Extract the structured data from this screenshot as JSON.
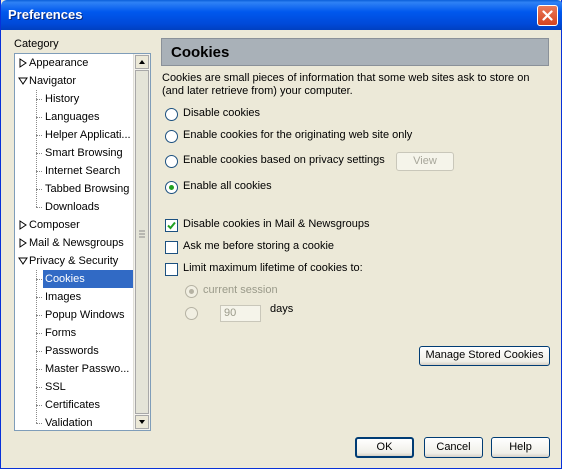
{
  "window": {
    "title": "Preferences"
  },
  "category": {
    "label": "Category",
    "items": [
      {
        "label": "Appearance",
        "level": 0,
        "expander": "collapsed"
      },
      {
        "label": "Navigator",
        "level": 0,
        "expander": "expanded"
      },
      {
        "label": "History",
        "level": 1
      },
      {
        "label": "Languages",
        "level": 1
      },
      {
        "label": "Helper Applicati...",
        "level": 1
      },
      {
        "label": "Smart Browsing",
        "level": 1
      },
      {
        "label": "Internet Search",
        "level": 1
      },
      {
        "label": "Tabbed Browsing",
        "level": 1
      },
      {
        "label": "Downloads",
        "level": 1
      },
      {
        "label": "Composer",
        "level": 0,
        "expander": "collapsed"
      },
      {
        "label": "Mail & Newsgroups",
        "level": 0,
        "expander": "collapsed"
      },
      {
        "label": "Privacy & Security",
        "level": 0,
        "expander": "expanded"
      },
      {
        "label": "Cookies",
        "level": 1,
        "selected": true
      },
      {
        "label": "Images",
        "level": 1
      },
      {
        "label": "Popup Windows",
        "level": 1
      },
      {
        "label": "Forms",
        "level": 1
      },
      {
        "label": "Passwords",
        "level": 1
      },
      {
        "label": "Master Passwo...",
        "level": 1
      },
      {
        "label": "SSL",
        "level": 1
      },
      {
        "label": "Certificates",
        "level": 1
      },
      {
        "label": "Validation",
        "level": 1
      }
    ]
  },
  "panel": {
    "title": "Cookies",
    "description": "Cookies are small pieces of information that some web sites ask to store on (and later retrieve from) your computer.",
    "radios": [
      {
        "label": "Disable cookies",
        "checked": false
      },
      {
        "label": "Enable cookies for the originating web site only",
        "checked": false
      },
      {
        "label": "Enable cookies based on privacy settings",
        "checked": false
      },
      {
        "label": "Enable all cookies",
        "checked": true
      }
    ],
    "view_button": "View",
    "checkboxes": [
      {
        "label": "Disable cookies in Mail & Newsgroups",
        "checked": true
      },
      {
        "label": "Ask me before storing a cookie",
        "checked": false
      },
      {
        "label": "Limit maximum lifetime of cookies to:",
        "checked": false
      }
    ],
    "lifetime": {
      "current_session_label": "current session",
      "days_value": "90",
      "days_label": "days"
    },
    "manage_button": "Manage Stored Cookies"
  },
  "buttons": {
    "ok": "OK",
    "cancel": "Cancel",
    "help": "Help"
  }
}
